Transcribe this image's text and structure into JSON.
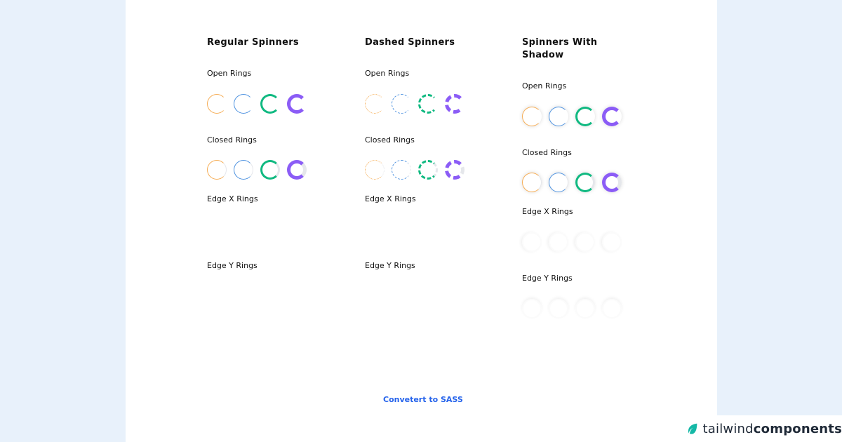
{
  "columns": [
    {
      "title": "Regular Spinners",
      "labels": [
        "Open Rings",
        "Closed Rings",
        "Edge X Rings",
        "Edge Y Rings"
      ]
    },
    {
      "title": "Dashed Spinners",
      "labels": [
        "Open Rings",
        "Closed Rings",
        "Edge X Rings",
        "Edge Y Rings"
      ]
    },
    {
      "title": "Spinners With Shadow",
      "labels": [
        "Open Rings",
        "Closed Rings",
        "Edge X Rings",
        "Edge Y Rings"
      ]
    }
  ],
  "colors": {
    "orange": "#f6ad55",
    "blue": "#4f93e0",
    "green": "#10b981",
    "purple": "#8b5cf6",
    "link": "#2563eb",
    "page_bg": "#e8f1fb"
  },
  "footer_link": "Convetert to SASS",
  "brand": {
    "part1": "tailwind",
    "part2": "components",
    "icon": "leaf-icon"
  }
}
